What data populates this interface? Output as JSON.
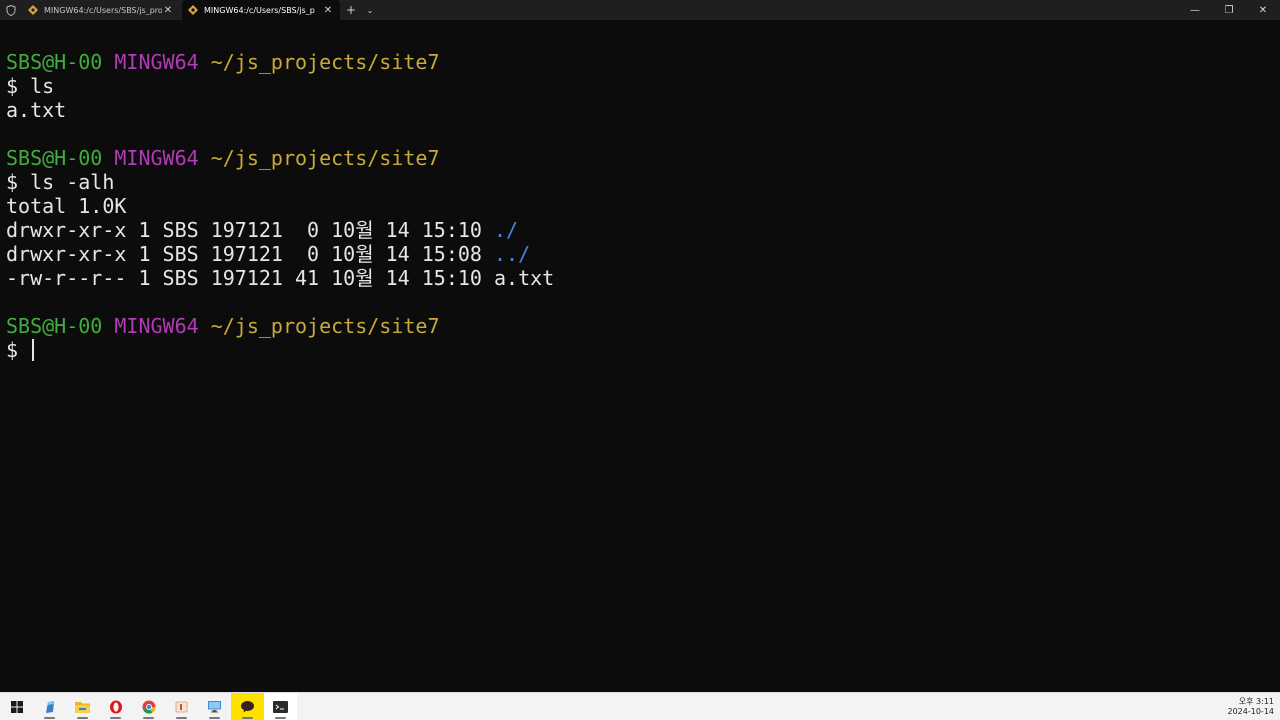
{
  "tabs": [
    {
      "label": "MINGW64:/c/Users/SBS/js_pro",
      "active": false
    },
    {
      "label": "MINGW64:/c/Users/SBS/js_p",
      "active": true
    }
  ],
  "tab_close_glyph": "✕",
  "new_tab_glyph": "+",
  "dropdown_glyph": "⌄",
  "window_controls": {
    "minimize": "—",
    "restore": "❐",
    "close": "✕"
  },
  "prompt": {
    "user": "SBS@H-00",
    "system": "MINGW64",
    "path": "~/js_projects/site7",
    "symbol": "$"
  },
  "session": {
    "cmd1": "ls",
    "out1": "a.txt",
    "cmd2": "ls -alh",
    "total": "total 1.0K",
    "rows": [
      {
        "meta": "drwxr-xr-x 1 SBS 197121  0 10월 14 15:10",
        "name": "./"
      },
      {
        "meta": "drwxr-xr-x 1 SBS 197121  0 10월 14 15:08",
        "name": "../"
      },
      {
        "meta": "-rw-r--r-- 1 SBS 197121 41 10월 14 15:10",
        "name": "a.txt"
      }
    ]
  },
  "colors": {
    "user": "#3fae3b",
    "system": "#b23ab6",
    "path": "#c9a93a",
    "dir": "#4b7fe0",
    "background": "#0c0c0c"
  },
  "taskbar": {
    "icons": [
      "windows-start-icon",
      "notepad-icon",
      "file-explorer-icon",
      "opera-icon",
      "chrome-icon",
      "app-icon",
      "remote-desktop-icon",
      "kakaotalk-icon",
      "terminal-icon"
    ],
    "clock_time": "오후 3:11",
    "clock_date": "2024-10-14"
  }
}
